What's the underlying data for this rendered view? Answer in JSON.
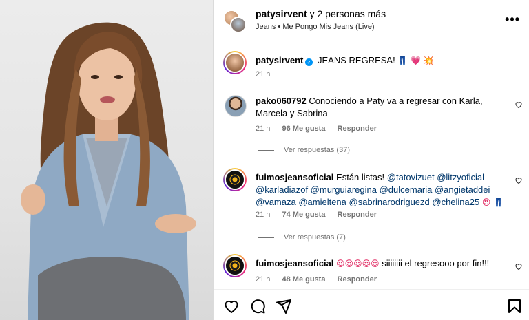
{
  "header": {
    "username": "patysirvent",
    "collab_suffix": " y 2 personas más",
    "audio": "Jeans • Me Pongo Mis Jeans (Live)",
    "more_label": "•••"
  },
  "caption": {
    "username": "patysirvent",
    "text": "JEANS REGRESA!",
    "emojis": "👖 💗 💥",
    "time": "21 h"
  },
  "comments": [
    {
      "username": "pako060792",
      "text": "Conociendo a Paty va a regresar con Karla, Marcela y Sabrina",
      "time": "21 h",
      "likes": "96 Me gusta",
      "reply": "Responder",
      "view_replies": "Ver respuestas (37)"
    },
    {
      "username": "fuimosjeansoficial",
      "text": "Están listas!",
      "mentions": "@tatovizuet @litzyoficial @karladiazof @murguiaregina @dulcemaria @angietaddei @vamaza @amieltena @sabrinarodriguezd @chelina25",
      "emojis": "😍 👖",
      "time": "21 h",
      "likes": "74 Me gusta",
      "reply": "Responder",
      "view_replies": "Ver respuestas (7)"
    },
    {
      "username": "fuimosjeansoficial",
      "emojis": "😍😍😍😍😍",
      "text": "siiiiiiii el regresooo por fin!!!",
      "time": "21 h",
      "likes": "48 Me gusta",
      "reply": "Responder"
    }
  ],
  "icons": {
    "like": "heart-icon",
    "comment": "comment-icon",
    "share": "share-icon",
    "save": "bookmark-icon"
  }
}
